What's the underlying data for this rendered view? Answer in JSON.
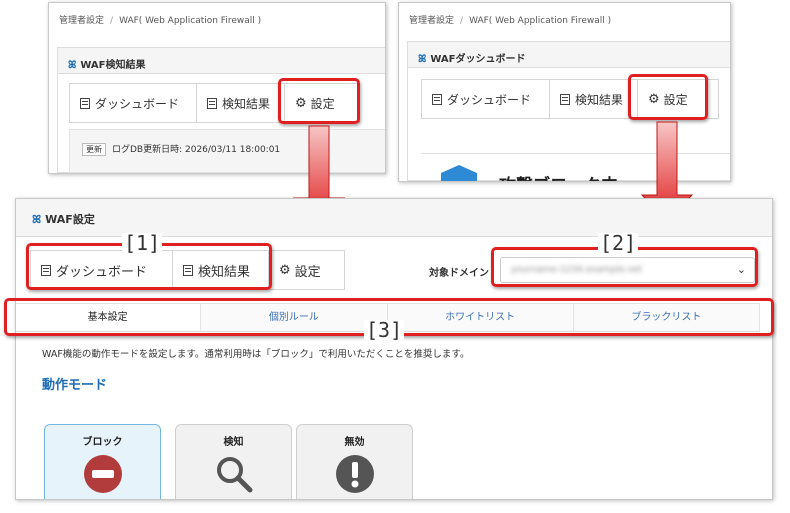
{
  "colors": {
    "highlight_red": "#e02020",
    "accent_blue": "#1e6db5",
    "stop_red": "#b23b3b",
    "icon_gray": "#555555"
  },
  "left_panel": {
    "breadcrumb": [
      "管理者設定",
      "WAF( Web Application Firewall )"
    ],
    "header": "WAF検知結果",
    "tabs": [
      "ダッシュボード",
      "検知結果",
      "設定"
    ],
    "badge": "更新",
    "log_update": "ログDB更新日時: 2026/03/11 18:00:01"
  },
  "right_panel": {
    "breadcrumb": [
      "管理者設定",
      "WAF( Web Application Firewall )"
    ],
    "header": "WAFダッシュボード",
    "tabs": [
      "ダッシュボード",
      "検知結果",
      "設定"
    ],
    "status": "攻撃ブロック中"
  },
  "main_panel": {
    "header": "WAF設定",
    "tabs": [
      "ダッシュボード",
      "検知結果",
      "設定"
    ],
    "domain_label": "対象ドメイン",
    "domain_value": "yourname-1234.example.net",
    "subtabs": [
      "基本設定",
      "個別ルール",
      "ホワイトリスト",
      "ブラックリスト"
    ],
    "description": "WAF機能の動作モードを設定します。通常利用時は「ブロック」で利用いただくことを推奨します。",
    "section_title": "動作モード",
    "modes": [
      "ブロック",
      "検知",
      "無効"
    ]
  },
  "callouts": [
    "[1]",
    "[2]",
    "[3]"
  ]
}
